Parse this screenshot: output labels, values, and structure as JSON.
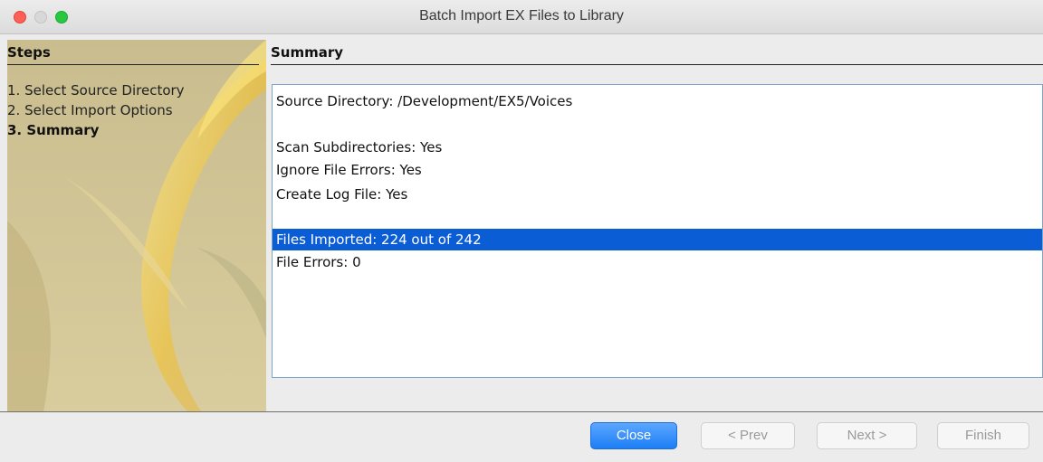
{
  "window": {
    "title": "Batch Import EX Files to Library"
  },
  "steps": {
    "header": "Steps",
    "items": [
      {
        "label": "1. Select Source Directory",
        "active": false
      },
      {
        "label": "2. Select Import Options",
        "active": false
      },
      {
        "label": "3. Summary",
        "active": true
      }
    ]
  },
  "summary": {
    "header": "Summary",
    "lines": {
      "source_directory": "Source Directory: /Development/EX5/Voices",
      "scan_subdirectories": "Scan Subdirectories: Yes",
      "ignore_file_errors": "Ignore File Errors: Yes",
      "create_log_file": "Create Log File: Yes",
      "files_imported": "Files Imported: 224 out of 242",
      "file_errors": "File Errors: 0"
    },
    "selected_line": "files_imported"
  },
  "buttons": {
    "close": "Close",
    "prev": "< Prev",
    "next": "Next >",
    "finish": "Finish"
  },
  "colors": {
    "selection": "#0b5dd6",
    "primary_button": "#1c7ef5",
    "panel_base": "#cdbf90"
  }
}
